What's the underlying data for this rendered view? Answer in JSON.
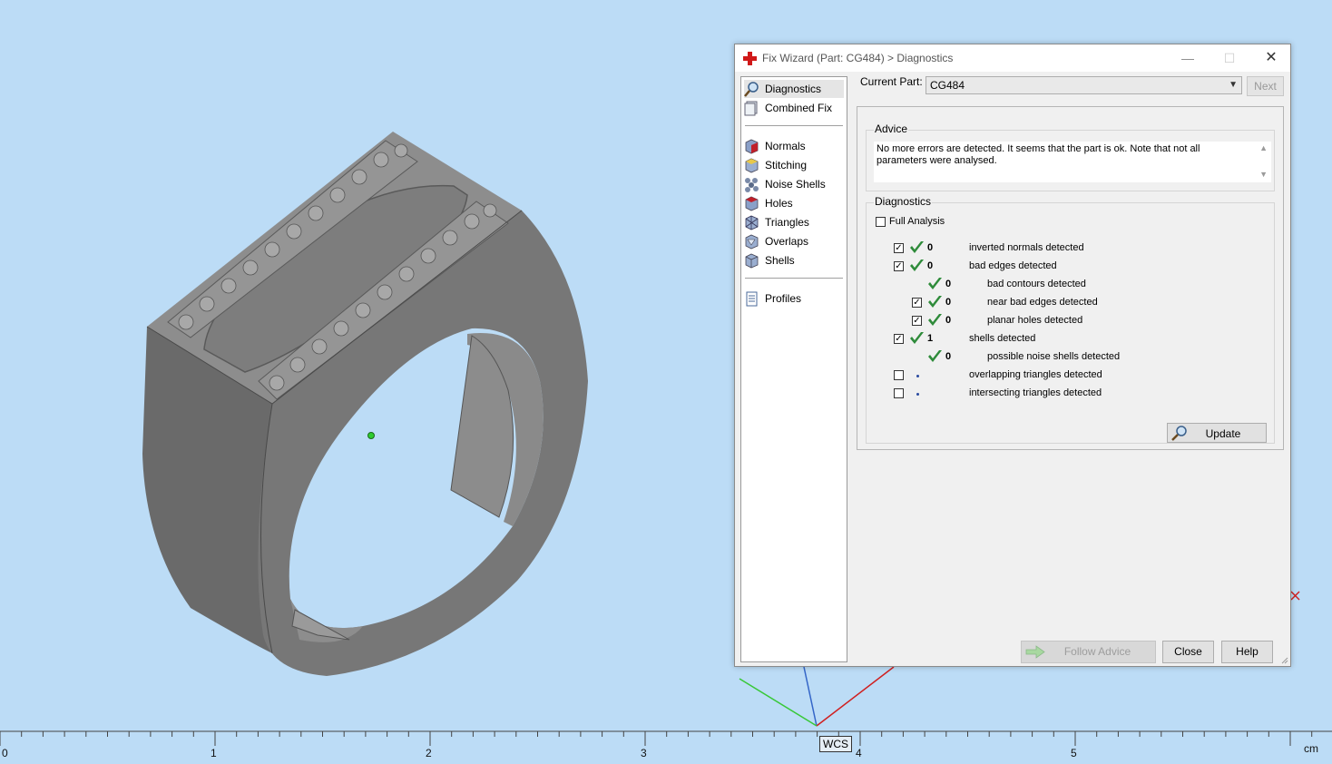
{
  "viewport": {
    "ruler_labels": [
      "0",
      "1",
      "2",
      "3",
      "4",
      "5"
    ],
    "ruler_unit": "cm",
    "wcs_label": "WCS",
    "background_color": "#bcdcf6",
    "model_color": "#6f6f6f"
  },
  "dialog": {
    "title": "Fix Wizard (Part: CG484) > Diagnostics",
    "title_icon": "red-cross-icon",
    "current_part_label": "Current Part:",
    "current_part_value": "CG484",
    "next_label": "Next",
    "sidebar": {
      "group1": [
        {
          "label": "Diagnostics",
          "icon": "magnifier-icon",
          "selected": true
        },
        {
          "label": "Combined Fix",
          "icon": "combined-fix-icon",
          "selected": false
        }
      ],
      "group2": [
        {
          "label": "Normals",
          "icon": "normals-icon"
        },
        {
          "label": "Stitching",
          "icon": "stitching-icon"
        },
        {
          "label": "Noise Shells",
          "icon": "noise-shells-icon"
        },
        {
          "label": "Holes",
          "icon": "holes-icon"
        },
        {
          "label": "Triangles",
          "icon": "triangles-icon"
        },
        {
          "label": "Overlaps",
          "icon": "overlaps-icon"
        },
        {
          "label": "Shells",
          "icon": "shells-icon"
        }
      ],
      "group3": [
        {
          "label": "Profiles",
          "icon": "profiles-icon"
        }
      ]
    },
    "advice": {
      "group_label": "Advice",
      "text": "No more errors are detected. It seems that the part is ok. Note that not all parameters were analysed."
    },
    "diagnostics": {
      "group_label": "Diagnostics",
      "full_analysis_label": "Full Analysis",
      "full_analysis_checked": false,
      "rows": [
        {
          "checkbox": true,
          "checked": true,
          "status": "ok",
          "count": "0",
          "label": "inverted normals detected",
          "indent": 0
        },
        {
          "checkbox": true,
          "checked": true,
          "status": "ok",
          "count": "0",
          "label": "bad edges detected",
          "indent": 0
        },
        {
          "checkbox": false,
          "checked": false,
          "status": "ok",
          "count": "0",
          "label": "bad contours detected",
          "indent": 1
        },
        {
          "checkbox": true,
          "checked": true,
          "status": "ok",
          "count": "0",
          "label": "near bad edges detected",
          "indent": 1
        },
        {
          "checkbox": true,
          "checked": true,
          "status": "ok",
          "count": "0",
          "label": "planar holes detected",
          "indent": 1
        },
        {
          "checkbox": true,
          "checked": true,
          "status": "ok",
          "count": "1",
          "label": "shells detected",
          "indent": 0
        },
        {
          "checkbox": false,
          "checked": false,
          "status": "ok",
          "count": "0",
          "label": "possible noise shells detected",
          "indent": 1
        },
        {
          "checkbox": true,
          "checked": false,
          "status": "not-analysed",
          "count": "",
          "label": "overlapping triangles detected",
          "indent": 0
        },
        {
          "checkbox": true,
          "checked": false,
          "status": "not-analysed",
          "count": "",
          "label": "intersecting triangles detected",
          "indent": 0
        }
      ],
      "update_label": "Update"
    },
    "buttons": {
      "follow_advice": "Follow Advice",
      "close": "Close",
      "help": "Help"
    }
  }
}
